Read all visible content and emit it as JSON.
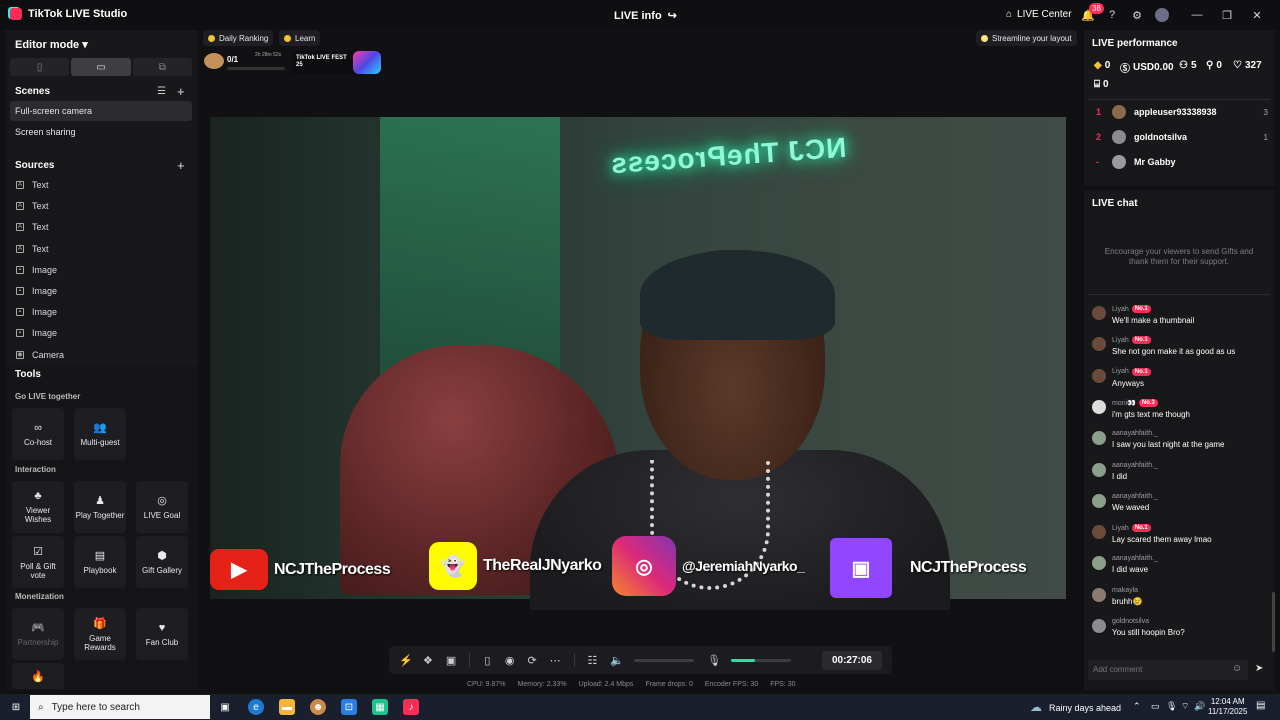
{
  "app": {
    "title": "TikTok LIVE Studio",
    "center_title": "LIVE info",
    "live_center": "LIVE Center",
    "notif_count": "38"
  },
  "left": {
    "editor_mode": "Editor mode",
    "scenes_title": "Scenes",
    "scenes": [
      "Full-screen camera",
      "Screen sharing"
    ],
    "sources_title": "Sources",
    "sources": [
      {
        "label": "Text",
        "icon": "text-icon"
      },
      {
        "label": "Text",
        "icon": "text-icon"
      },
      {
        "label": "Text",
        "icon": "text-icon"
      },
      {
        "label": "Text",
        "icon": "text-icon"
      },
      {
        "label": "Image",
        "icon": "image-icon"
      },
      {
        "label": "Image",
        "icon": "image-icon"
      },
      {
        "label": "Image",
        "icon": "image-icon"
      },
      {
        "label": "Image",
        "icon": "image-icon"
      },
      {
        "label": "Camera",
        "icon": "camera-icon"
      }
    ],
    "tools_title": "Tools",
    "go_live_title": "Go LIVE together",
    "go_live": [
      "Co-host",
      "Multi-guest"
    ],
    "interaction_title": "Interaction",
    "interaction": [
      "Viewer Wishes",
      "Play Together",
      "LIVE Goal",
      "Poll & Gift vote",
      "Playbook",
      "Gift Gallery"
    ],
    "monetization_title": "Monetization",
    "monetization": [
      "Partnership",
      "Game Rewards",
      "Fan Club"
    ]
  },
  "top": {
    "daily_ranking": "Daily Ranking",
    "learn": "Learn",
    "progress": "0/1",
    "countdown": "2h 28m 52s",
    "fest": "TikTok LIVE FEST 25",
    "streamline": "Streamline your layout"
  },
  "overlay": {
    "youtube": "NCJTheProcess",
    "snapchat": "TheRealJNyarko",
    "instagram": "@JeremiahNyarko_",
    "twitch": "NCJTheProcess",
    "neon": "NCJ TheProcess"
  },
  "controls": {
    "timer": "00:27:06",
    "mic_level_pct": 40
  },
  "stats": [
    "CPU: 9.87%",
    "Memory: 2.33%",
    "Upload: 2.4 Mbps",
    "Frame drops: 0",
    "Encoder FPS: 30",
    "FPS: 30"
  ],
  "performance": {
    "title": "LIVE performance",
    "diamonds": "0",
    "usd": "USD0.00",
    "viewers": "5",
    "new_followers": "0",
    "likes": "327",
    "gifts": "0",
    "ranking": [
      {
        "rank": "1",
        "name": "appleuser93338938",
        "score": "3"
      },
      {
        "rank": "2",
        "name": "goldnotsilva",
        "score": "1"
      },
      {
        "rank": "-",
        "name": "Mr Gabby",
        "score": ""
      }
    ]
  },
  "chat": {
    "title": "LIVE chat",
    "hint": "Encourage your viewers to send Gifts and thank them for their support.",
    "messages": [
      {
        "name": "Liyah",
        "badge": "No.1",
        "text": "We'll make a thumbnail"
      },
      {
        "name": "Liyah",
        "badge": "No.1",
        "text": "She not gon make it as good as us"
      },
      {
        "name": "Liyah",
        "badge": "No.1",
        "text": "Anyways"
      },
      {
        "name": "moni👀",
        "badge": "No.3",
        "text": "i'm gts text me though"
      },
      {
        "name": "aanayahfaith._",
        "badge": "",
        "text": "I saw you last night at the game"
      },
      {
        "name": "aanayahfaith._",
        "badge": "",
        "text": "I did"
      },
      {
        "name": "aanayahfaith._",
        "badge": "",
        "text": "We waved"
      },
      {
        "name": "Liyah",
        "badge": "No.1",
        "text": "Lay scared them away lmao"
      },
      {
        "name": "aanayahfaith._",
        "badge": "",
        "text": "I did wave"
      },
      {
        "name": "makayla",
        "badge": "",
        "text": "bruhh😢"
      },
      {
        "name": "goldnotsilva",
        "badge": "",
        "text": "You still hoopin Bro?"
      }
    ],
    "placeholder": "Add comment"
  },
  "taskbar": {
    "search": "Type here to search",
    "weather": "Rainy days ahead",
    "time": "12:04 AM",
    "date": "11/17/2025"
  }
}
